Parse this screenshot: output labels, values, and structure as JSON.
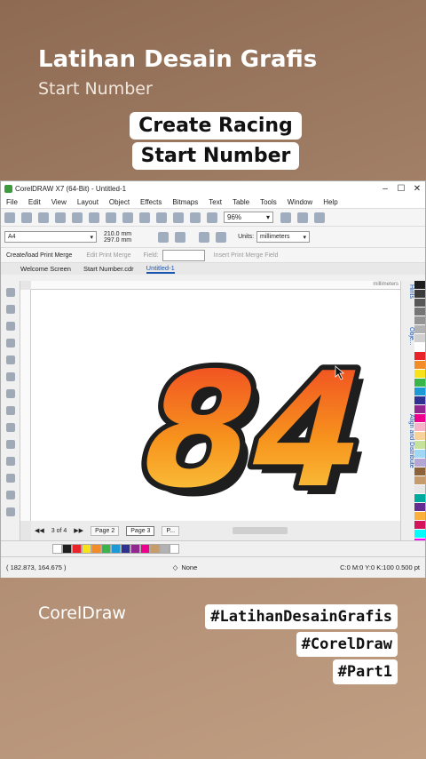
{
  "overlay": {
    "title": "Latihan Desain Grafis",
    "subtitle": "Start Number",
    "headline": "Create Racing Start Number",
    "footer_left": "CorelDraw",
    "tags": [
      "#LatihanDesainGrafis",
      "#CorelDraw",
      "#Part1"
    ]
  },
  "app": {
    "window_title": "CorelDRAW X7 (64-Bit) - Untitled-1",
    "menu": [
      "File",
      "Edit",
      "View",
      "Layout",
      "Object",
      "Effects",
      "Bitmaps",
      "Text",
      "Table",
      "Tools",
      "Window",
      "Help"
    ],
    "zoom": "96%",
    "page_size": "A4",
    "width": "210.0 mm",
    "height": "297.0 mm",
    "units_label": "Units:",
    "units_value": "millimeters",
    "print_merge": "Create/load Print Merge",
    "edit_print_merge": "Edit Print Merge",
    "field_label": "Field:",
    "insert_print_merge": "Insert Print Merge Field",
    "tabs": [
      "Welcome Screen",
      "Start Number.cdr",
      "Untitled-1"
    ],
    "ruler_unit": "millimeters",
    "artwork_text": "84",
    "dockers": [
      "Hints",
      "Obje...",
      "Align and Distribute"
    ],
    "page_counter": "3 of 4",
    "pages": [
      "Page 2",
      "Page 3",
      "P..."
    ],
    "cursor_coords": "( 182.873, 164.675 )",
    "fill_none": "None",
    "color_readout": "C:0 M:0 Y:0 K:100  0.500 pt",
    "palette": [
      "#1e1e1e",
      "#3a3a3a",
      "#585858",
      "#767676",
      "#949494",
      "#b2b2b2",
      "#d0d0d0",
      "#ffffff",
      "#e8232a",
      "#f28c28",
      "#f7e21b",
      "#39b54a",
      "#1d9ad6",
      "#2e3192",
      "#92278f",
      "#ec008c",
      "#f7b3c8",
      "#f9d29a",
      "#c7e29a",
      "#9fd7f5",
      "#b4a7d6",
      "#8c6239",
      "#c69c6d",
      "#e6e6e6",
      "#00a99d",
      "#662d91",
      "#fbb03b",
      "#d4145a",
      "#00ffff",
      "#ff00ff"
    ],
    "colorbar": [
      "#ffffff",
      "#1e1e1e",
      "#e8232a",
      "#f7e21b",
      "#f28c28",
      "#39b54a",
      "#1d9ad6",
      "#2e3192",
      "#92278f",
      "#ec008c",
      "#c69c6d",
      "#b2b2b2",
      "#ffffff"
    ]
  }
}
